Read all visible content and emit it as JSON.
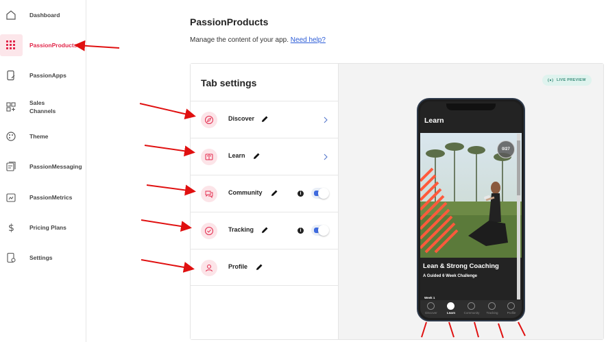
{
  "sidebar": {
    "items": [
      {
        "label": "Dashboard",
        "icon": "home-icon"
      },
      {
        "label": "PassionProducts",
        "icon": "grid-icon",
        "active": true
      },
      {
        "label": "PassionApps",
        "icon": "app-edit-icon"
      },
      {
        "label": "Sales Channels",
        "icon": "channels-icon"
      },
      {
        "label": "Theme",
        "icon": "palette-icon"
      },
      {
        "label": "PassionMessaging",
        "icon": "messaging-icon"
      },
      {
        "label": "PassionMetrics",
        "icon": "metrics-icon"
      },
      {
        "label": "Pricing Plans",
        "icon": "dollar-icon"
      },
      {
        "label": "Settings",
        "icon": "settings-icon"
      }
    ]
  },
  "page": {
    "title": "PassionProducts",
    "subtitle": "Manage the content of your app.",
    "help_link": "Need help?"
  },
  "tab_settings": {
    "title": "Tab settings",
    "tabs": [
      {
        "label": "Discover",
        "icon": "compass-icon",
        "has_chevron": true
      },
      {
        "label": "Learn",
        "icon": "book-icon",
        "has_chevron": true
      },
      {
        "label": "Community",
        "icon": "chat-icon",
        "has_toggle": true,
        "toggle_on": true
      },
      {
        "label": "Tracking",
        "icon": "check-circle-icon",
        "has_toggle": true,
        "toggle_on": true
      },
      {
        "label": "Profile",
        "icon": "user-icon"
      }
    ]
  },
  "preview": {
    "badge": "LIVE PREVIEW",
    "screen_title": "Learn",
    "progress": "0/27",
    "card_title": "Lean & Strong Coaching",
    "card_subtitle": "A Guided 6 Week Challenge",
    "week_label": "Week 1",
    "tabbar": [
      {
        "label": "Discover",
        "active": false
      },
      {
        "label": "Learn",
        "active": true
      },
      {
        "label": "Community",
        "active": false
      },
      {
        "label": "Tracking",
        "active": false
      },
      {
        "label": "Profile",
        "active": false
      }
    ]
  },
  "colors": {
    "accent": "#e2274a",
    "accent_bg": "#fce6ea",
    "link": "#2a5bd7",
    "toggle": "#3f6be0",
    "annotation": "#e01010"
  }
}
